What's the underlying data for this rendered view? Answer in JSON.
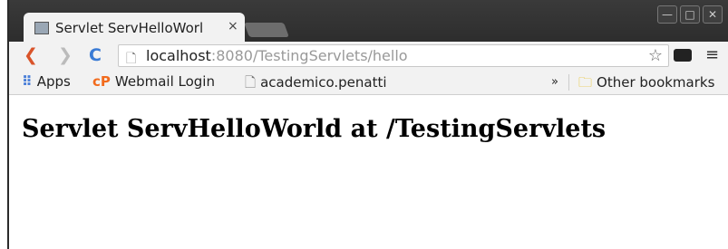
{
  "tab": {
    "title": "Servlet ServHelloWorl",
    "close": "×",
    "icon": "image-icon"
  },
  "window_controls": {
    "minimize": "—",
    "maximize": "□",
    "close": "✕"
  },
  "toolbar": {
    "back": "❮",
    "forward": "❯",
    "reload": "C",
    "url_host": "localhost",
    "url_rest": ":8080/TestingServlets/hello",
    "star": "☆",
    "menu": "≡"
  },
  "bookmarks": {
    "apps": "Apps",
    "webmail_icon": "cP",
    "webmail": "Webmail Login",
    "academico": "academico.penatti",
    "overflow": "»",
    "other": "Other bookmarks"
  },
  "page": {
    "heading": "Servlet ServHelloWorld at /TestingServlets"
  },
  "colors": {
    "back_arrow": "#d9542a",
    "reload": "#3a7bd5",
    "cpanel": "#f26b1d",
    "apps_grid": "#4a7fd8",
    "folder": "#e6b800"
  }
}
